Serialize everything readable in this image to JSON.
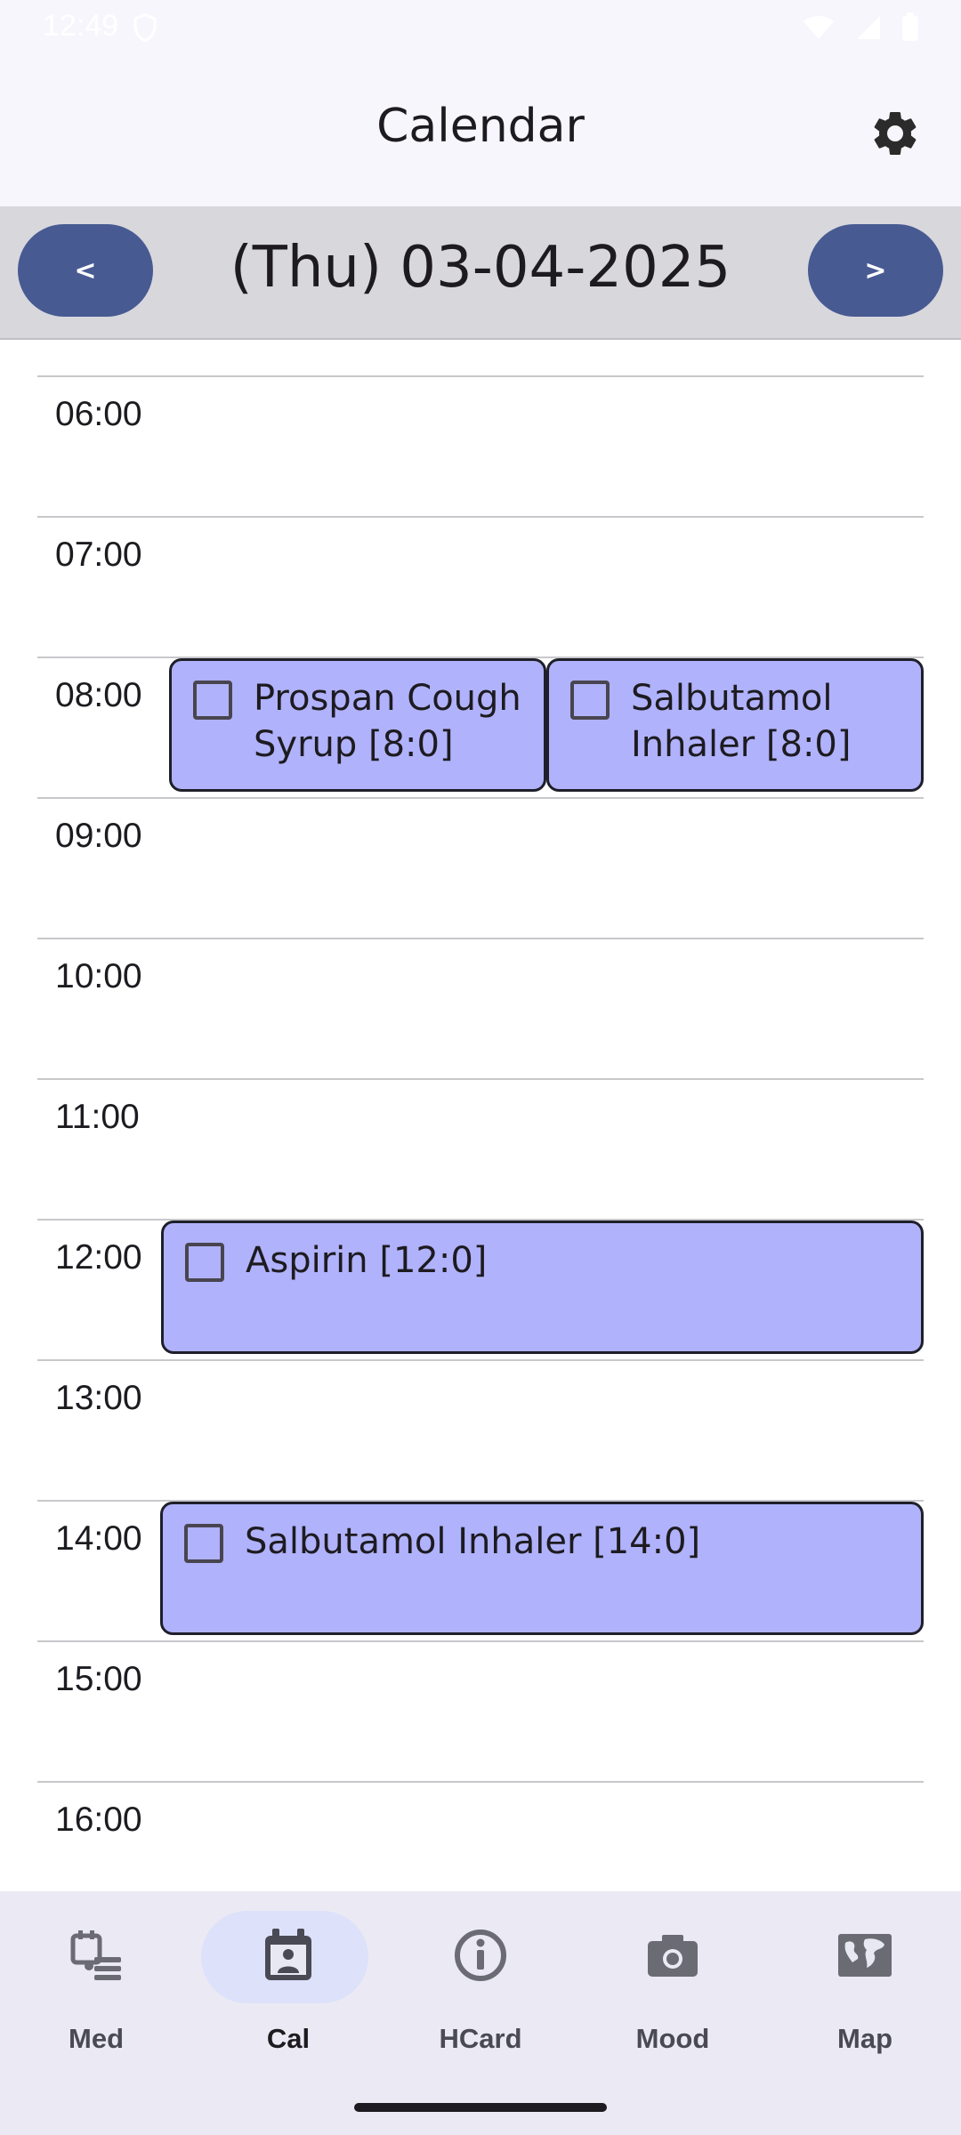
{
  "status_bar": {
    "time": "12:49"
  },
  "app_bar": {
    "title": "Calendar",
    "settings_icon": "gear-icon"
  },
  "date_nav": {
    "prev_label": "<",
    "next_label": ">",
    "date": "(Thu) 03-04-2025"
  },
  "schedule": {
    "hours": [
      "06:00",
      "07:00",
      "08:00",
      "09:00",
      "10:00",
      "11:00",
      "12:00",
      "13:00",
      "14:00",
      "15:00",
      "16:00"
    ],
    "events": [
      {
        "label": "Prospan Cough Syrup [8:0]",
        "hour": "08:00",
        "checked": false
      },
      {
        "label": "Salbutamol Inhaler [8:0]",
        "hour": "08:00",
        "checked": false
      },
      {
        "label": "Aspirin [12:0]",
        "hour": "12:00",
        "checked": false
      },
      {
        "label": "Salbutamol Inhaler [14:0]",
        "hour": "14:00",
        "checked": false
      }
    ]
  },
  "bottom_nav": {
    "items": [
      {
        "label": "Med",
        "icon": "medication-list-icon"
      },
      {
        "label": "Cal",
        "icon": "calendar-person-icon",
        "active": true
      },
      {
        "label": "HCard",
        "icon": "info-icon"
      },
      {
        "label": "Mood",
        "icon": "camera-icon"
      },
      {
        "label": "Map",
        "icon": "world-map-icon"
      }
    ]
  },
  "colors": {
    "accent": "#475a92",
    "event_fill": "#b0b2fb",
    "date_bar": "#d8d7dc",
    "nav_background": "#ebeaf4",
    "nav_indicator": "#dde1f9"
  }
}
